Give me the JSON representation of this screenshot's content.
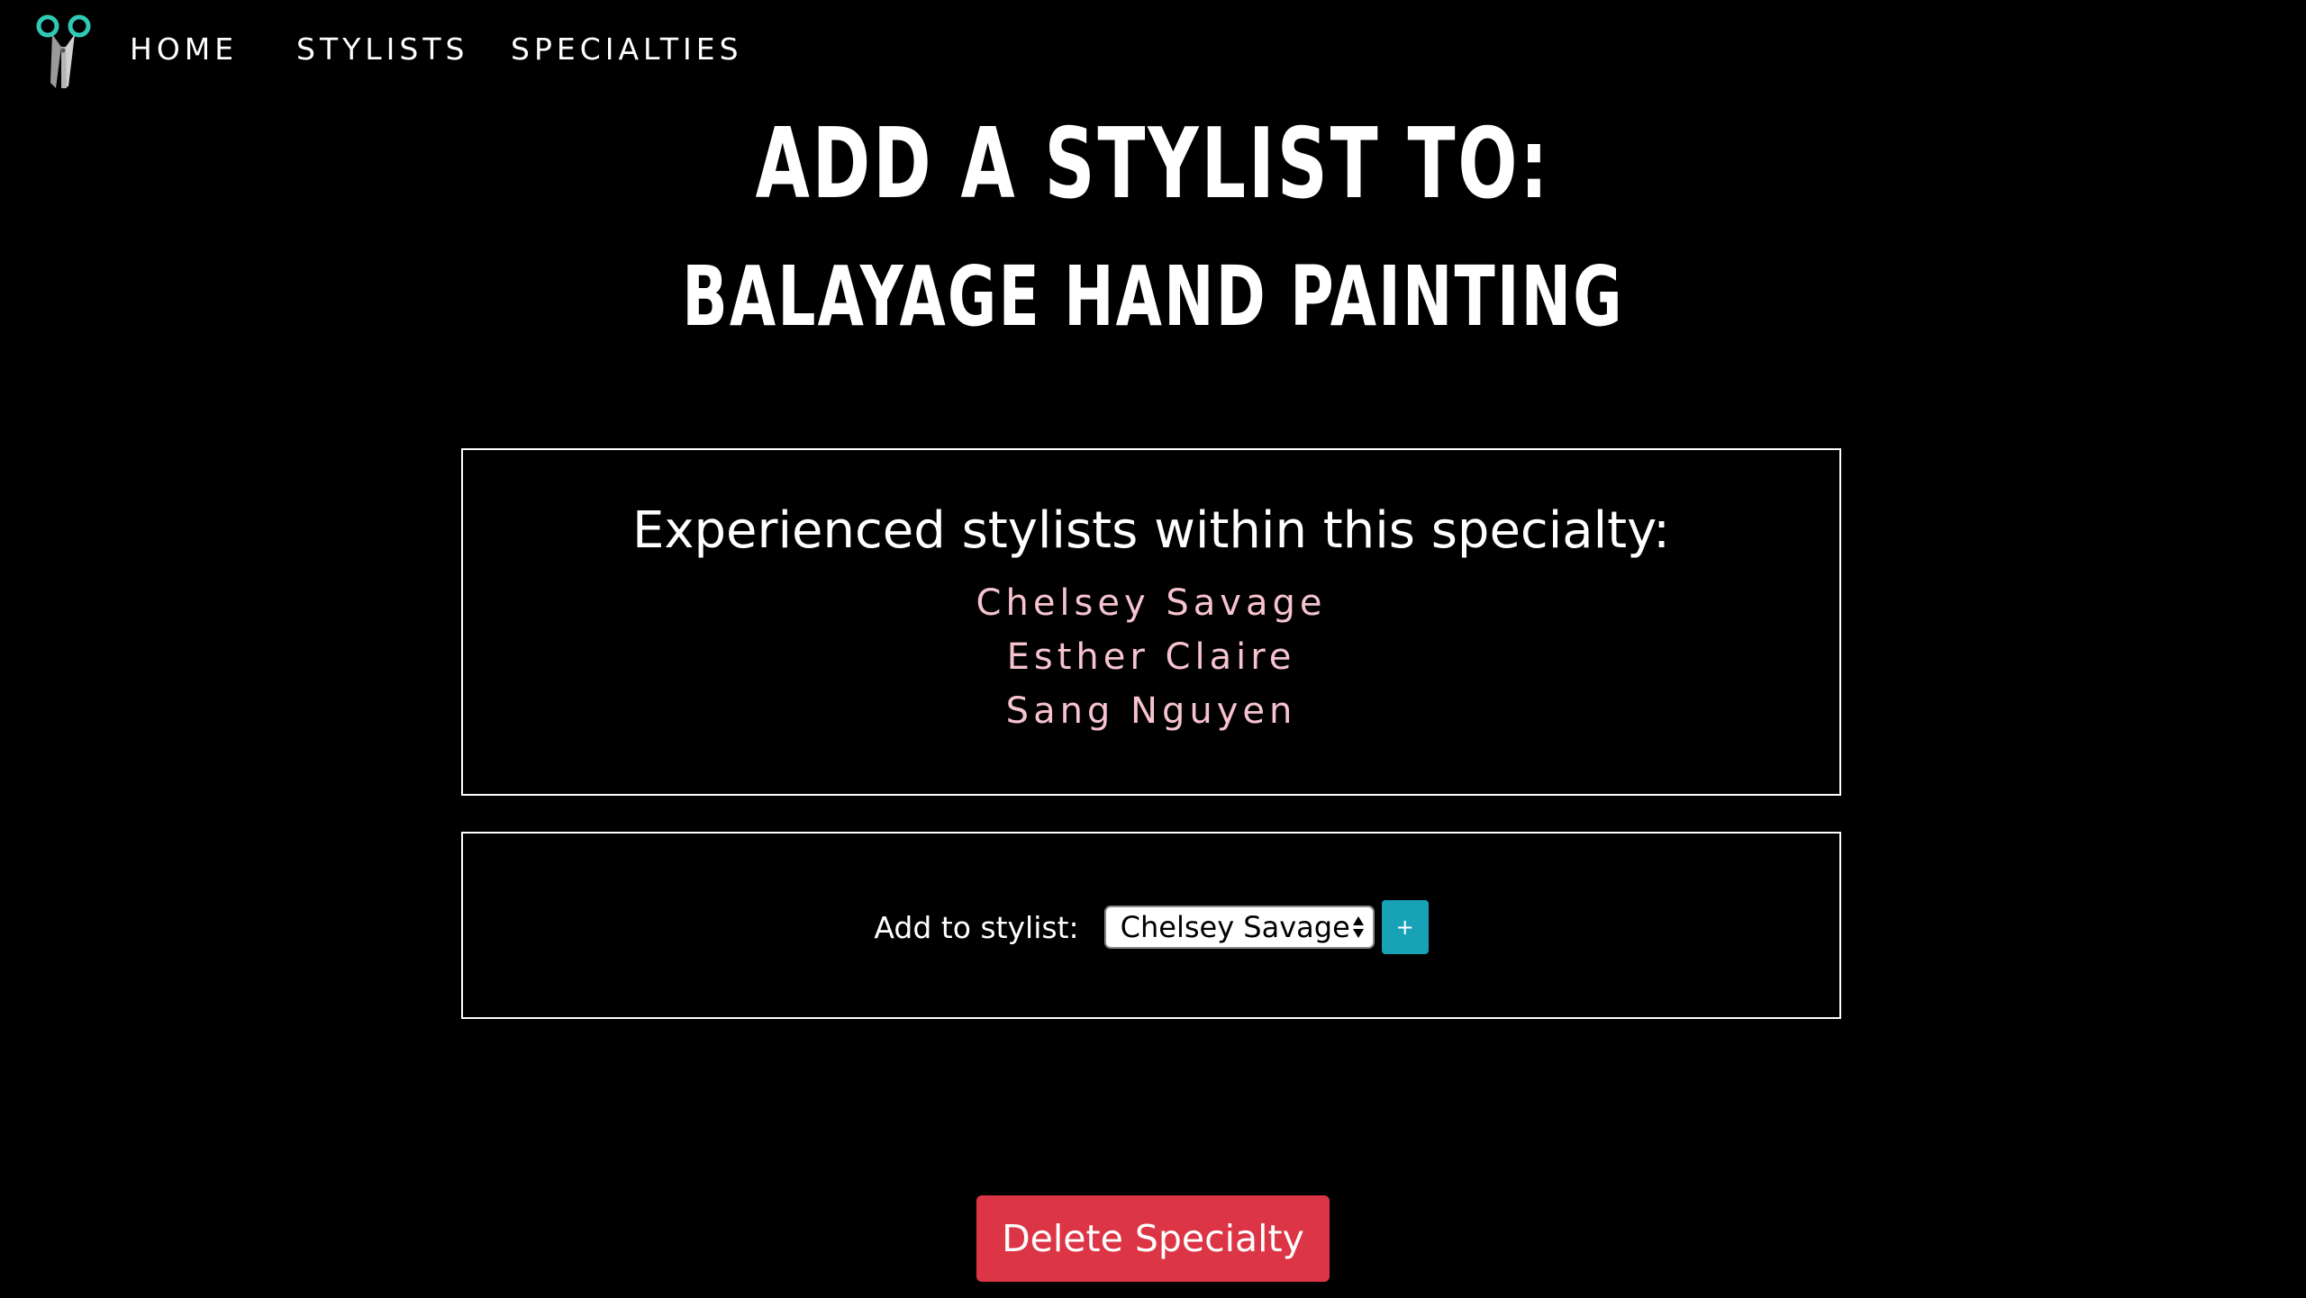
{
  "nav": {
    "logo_icon": "scissors-icon",
    "items": [
      {
        "label": "HOME"
      },
      {
        "label": "STYLISTS"
      },
      {
        "label": "SPECIALTIES"
      }
    ]
  },
  "heading": {
    "title": "ADD A STYLIST TO:",
    "specialty": "BALAYAGE HAND PAINTING"
  },
  "stylists_panel": {
    "title": "Experienced stylists within this specialty:",
    "stylists": [
      "Chelsey Savage",
      "Esther Claire",
      "Sang Nguyen"
    ]
  },
  "add_form": {
    "label": "Add to stylist:",
    "selected_stylist": "Chelsey Savage",
    "add_button_label": "+"
  },
  "actions": {
    "delete_label": "Delete Specialty"
  },
  "colors": {
    "background": "#000000",
    "accent_teal": "#2fc9b5",
    "stylist_name": "#f6c3cf",
    "add_button": "#17a2b8",
    "delete_button": "#dc3545"
  }
}
